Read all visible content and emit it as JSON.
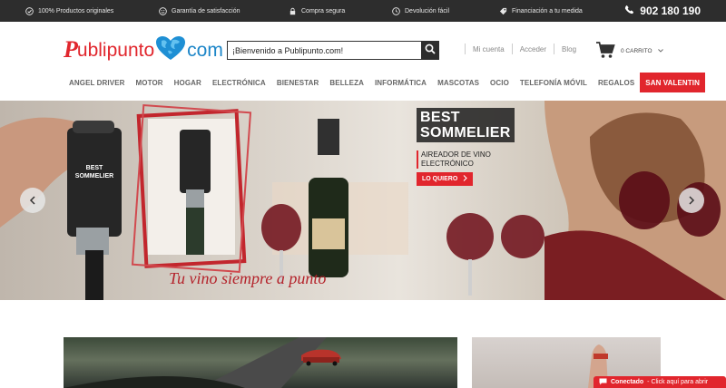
{
  "topbar": {
    "items": [
      {
        "icon": "check-circle-icon",
        "label": "100% Productos originales"
      },
      {
        "icon": "smile-icon",
        "label": "Garantía de satisfacción"
      },
      {
        "icon": "lock-icon",
        "label": "Compra segura"
      },
      {
        "icon": "clock-icon",
        "label": "Devolución fácil"
      },
      {
        "icon": "tag-icon",
        "label": "Financiación a tu medida"
      }
    ],
    "phone": "902 180 190"
  },
  "header": {
    "logo": {
      "p": "P",
      "ubli": "ublipunto",
      "com": "com"
    },
    "search": {
      "value": "¡Bienvenido a Publipunto.com!"
    },
    "account": {
      "my_account": "Mi cuenta",
      "login": "Acceder",
      "blog": "Blog"
    },
    "cart": {
      "label": "0 CARRITO"
    }
  },
  "nav": {
    "items": [
      "ANGEL DRIVER",
      "MOTOR",
      "HOGAR",
      "ELECTRÓNICA",
      "BIENESTAR",
      "BELLEZA",
      "INFORMÁTICA",
      "MASCOTAS",
      "OCIO",
      "TELEFONÍA MÓVIL",
      "REGALOS",
      "SAN VALENTIN"
    ]
  },
  "hero": {
    "headline_line1": "BEST",
    "headline_line2": "SOMMELIER",
    "sub_line1": "AIREADOR DE VINO",
    "sub_line2": "ELECTRÓNICO",
    "cta": "LO QUIERO",
    "slogan": "Tu vino siempre a punto",
    "product_label_line1": "BEST",
    "product_label_line2": "SOMMELIER"
  },
  "chat": {
    "status": "Conectado",
    "action": "- Click aquí para abrir"
  },
  "colors": {
    "brand_red": "#e1262d",
    "brand_blue": "#1d86c8",
    "topbar": "#2d2d2d"
  }
}
